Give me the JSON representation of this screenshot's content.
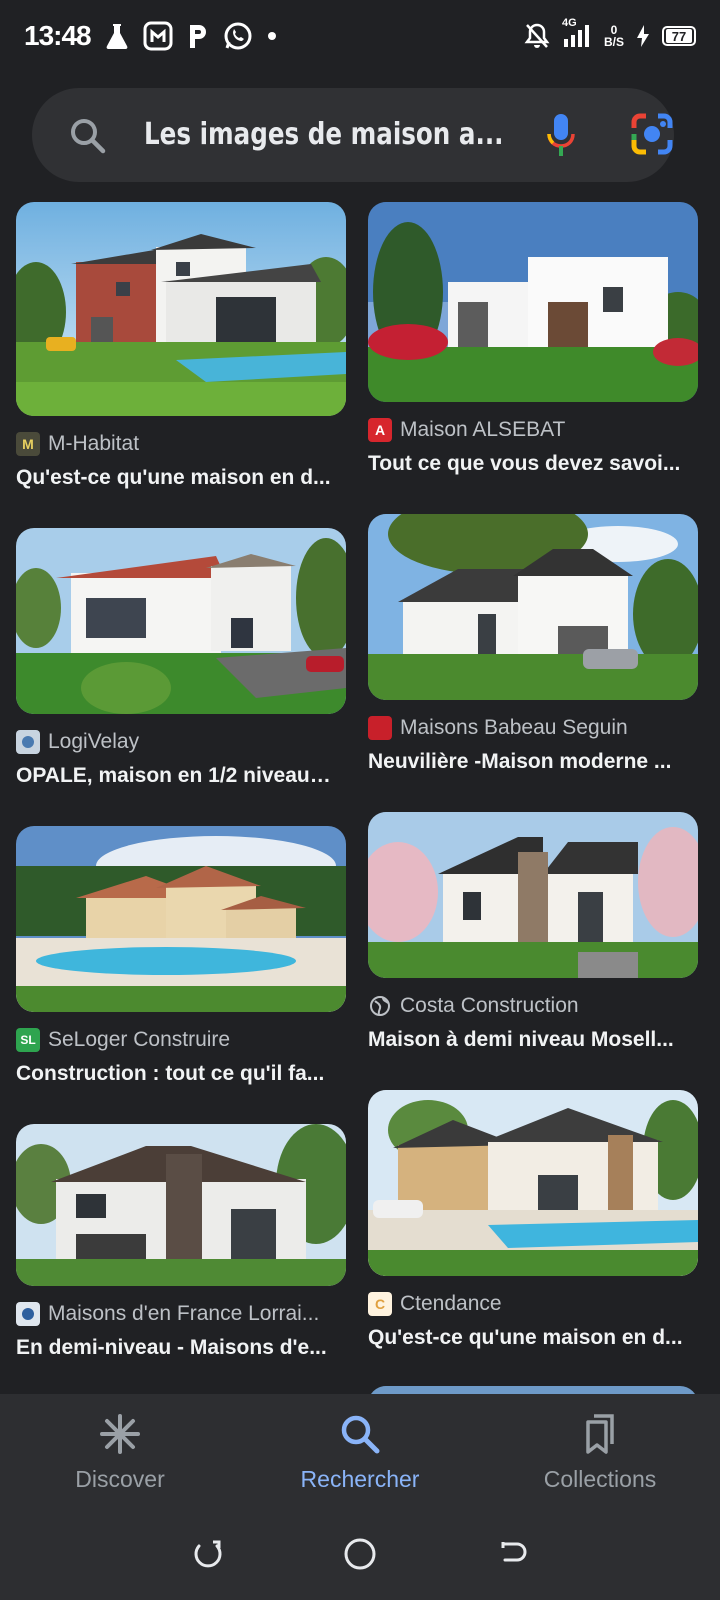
{
  "status_bar": {
    "time": "13:48",
    "network": "4G",
    "speed_value": "0",
    "speed_unit": "B/S",
    "battery": "77"
  },
  "search": {
    "query": "Les images de maison a..."
  },
  "results_left": [
    {
      "source": "M-Habitat",
      "title": "Qu'est-ce qu'une maison en d...",
      "favicon": "M"
    },
    {
      "source": "LogiVelay",
      "title": "OPALE, maison en 1/2 niveau,...",
      "favicon": ""
    },
    {
      "source": "SeLoger Construire",
      "title": "Construction : tout ce qu'il fa...",
      "favicon": "SL"
    },
    {
      "source": "Maisons d'en France Lorrai...",
      "title": "En demi-niveau - Maisons d'e...",
      "favicon": ""
    }
  ],
  "results_right": [
    {
      "source": "Maison ALSEBAT",
      "title": "Tout ce que vous devez savoi...",
      "favicon": "A"
    },
    {
      "source": "Maisons Babeau Seguin",
      "title": "Neuvilière -Maison moderne ...",
      "favicon": ""
    },
    {
      "source": "Costa Construction",
      "title": "Maison à demi niveau Mosell...",
      "favicon": ""
    },
    {
      "source": "Ctendance",
      "title": "Qu'est-ce qu'une maison en d...",
      "favicon": "C"
    }
  ],
  "bottom_nav": {
    "discover": "Discover",
    "search": "Rechercher",
    "collections": "Collections"
  }
}
